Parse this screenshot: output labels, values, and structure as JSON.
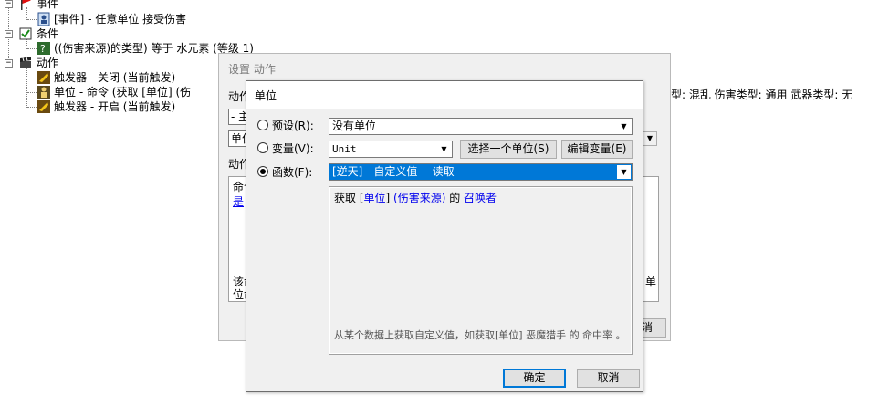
{
  "tree": {
    "event_header": "事件",
    "event_item": "[事件] - 任意单位 接受伤害",
    "condition_header": "条件",
    "condition_item": "((伤害来源)的类型) 等于 水元素 (等级 1)",
    "action_header": "动作",
    "action_items": [
      "触发器 - 关闭 (当前触发)",
      "单位 - 命令 (获取 [单位] (伤",
      "触发器 - 开启 (当前触发)"
    ],
    "action_item_overflow": "型: 混乱 伤害类型: 通用 武器类型: 无"
  },
  "back_dialog": {
    "title": "设置 动作",
    "label_top": "动作",
    "combo1_value": "- 主",
    "combo2_value": "单位",
    "label_text": "动作",
    "panel_line1": "命令",
    "panel_link": "是",
    "panel_bottom_left": "该命令",
    "panel_bottom_left2": "位命",
    "panel_bottom_right": "单",
    "button_fragment": "消"
  },
  "dialog": {
    "title": "单位",
    "preset": {
      "label": "预设(R):",
      "value": "没有单位",
      "selected": false
    },
    "variable": {
      "label": "变量(V):",
      "value": "Unit",
      "selected": false
    },
    "function": {
      "label": "函数(F):",
      "value": "[逆天] - 自定义值 -- 读取",
      "selected": true
    },
    "select_unit_button": "选择一个单位(S)",
    "edit_variable_button": "编辑变量(E)",
    "expression": {
      "prefix": "获取 [",
      "link_unit": "单位",
      "sep": "] ",
      "link_source": "(伤害来源)",
      "mid": " 的 ",
      "link_summoner": "召唤者"
    },
    "description": "从某个数据上获取自定义值，如获取[单位] 恶魔猎手 的 命中率 。",
    "ok_button": "确定",
    "cancel_button": "取消"
  },
  "colors": {
    "selection": "#0078d7",
    "link": "#0000ee",
    "dialog_bg": "#f0f0f0"
  }
}
